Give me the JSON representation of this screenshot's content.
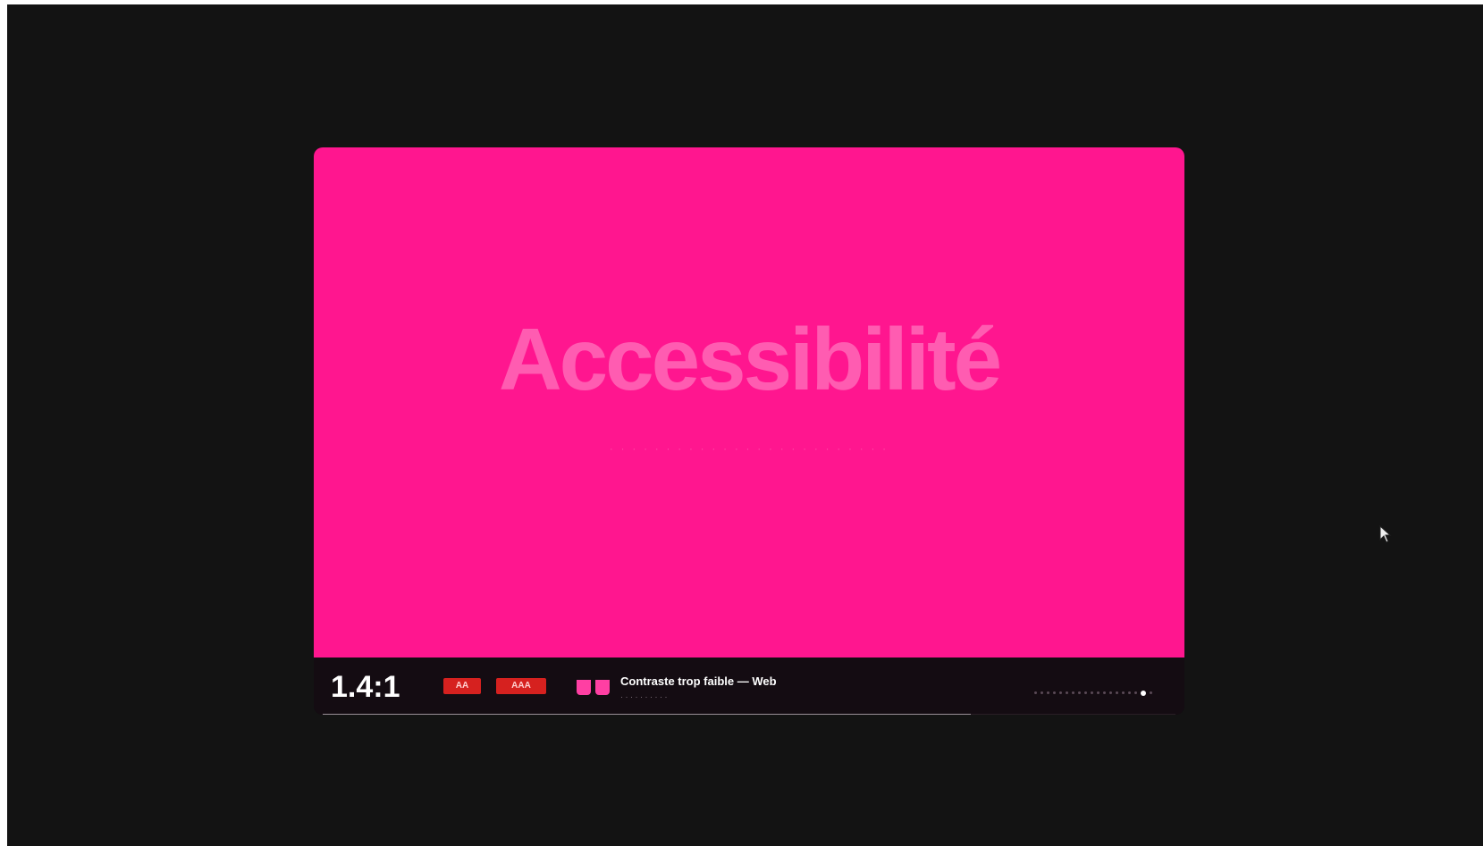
{
  "slide": {
    "title": "Accessibilité",
    "subtitle": "· · · · · · · · · · · · · · · · · · · · · · · · ·"
  },
  "footer": {
    "criterion_number": "1.4:1",
    "badges": [
      {
        "label": "AA"
      },
      {
        "label": "AAA"
      }
    ],
    "info_title": "Contraste trop faible — Web",
    "info_meta": "· · · · · · · · · ·",
    "dots_total": 19,
    "dots_active_index": 17,
    "progress_fraction": 0.76
  },
  "colors": {
    "background": "#131313",
    "slide_pink": "#ff168f",
    "slide_text": "#ff5cb1",
    "badge_red": "#d6211f",
    "footer_bg": "#140c12"
  }
}
